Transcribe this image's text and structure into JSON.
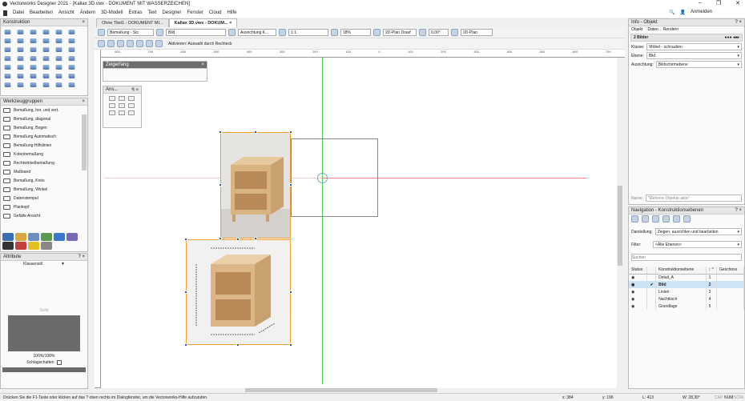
{
  "window": {
    "title": "Vectorworks Designer 2021 - [Kallax 3D.vwx - DOKUMENT MIT WASSERZEICHEN]",
    "controls": [
      "–",
      "❐",
      "✕"
    ]
  },
  "menu": [
    "Datei",
    "Bearbeiten",
    "Ansicht",
    "Ändern",
    "3D-Modell",
    "Extras",
    "Text",
    "Designer",
    "Fenster",
    "Cloud",
    "Hilfe"
  ],
  "account": {
    "login": "Anmelden"
  },
  "tabs": [
    {
      "label": "Ohne Titel1 - DOKUMENT MI..."
    },
    {
      "label": "Kallax 3D.vwx - DOKUM... ×"
    }
  ],
  "toolbar": {
    "class": "Bemaßung - Stc",
    "layer": "Bild",
    "alignment": "Ausrichtung K...",
    "scale": "1:1",
    "zoom": "18%",
    "view": "2D-Plan Drauf",
    "angle": "0.00°",
    "render": "2D-Plan",
    "mode_text": "Aktivieren: Auswahl durch Rechteck"
  },
  "ruler": {
    "h": [
      "800",
      "700",
      "600",
      "500",
      "400",
      "300",
      "200",
      "100",
      "0",
      "100",
      "200",
      "300",
      "400",
      "500",
      "600",
      "700"
    ]
  },
  "panels": {
    "konstruktion": {
      "title": "Konstruktion"
    },
    "werkzeuggruppen": {
      "title": "Werkzeuggruppen",
      "items": [
        "Bemaßung, hor. und vert.",
        "Bemaßung, diagonal",
        "Bemaßung, Bogen",
        "Bemaßung Automatisch",
        "Bemaßung Hilfslinien",
        "Kotenbemaßung",
        "Rechtwinkelbemaßung",
        "Maßband",
        "Bemaßung, Kreis",
        "Bemaßung, Winkel",
        "Datenstempel",
        "Plankopf",
        "Gefälle Ansicht"
      ]
    },
    "attribute": {
      "title": "Attribute",
      "fill": "Klassenstil",
      "line": "Solid",
      "opacity": "100%/100%",
      "shadow": "Schlagschatten"
    },
    "zeigerfang": {
      "title": "Zeigerfang"
    },
    "ans": {
      "title": "Ans..."
    },
    "info": {
      "title": "Info - Objekt",
      "tabs": [
        "Objekt",
        "Daten",
        "Rendern"
      ],
      "selection": "2 Bilder",
      "fields": [
        {
          "label": "Klasse:",
          "value": "Möbel - schrauben"
        },
        {
          "label": "Ebene:",
          "value": "Bild"
        },
        {
          "label": "Ausrichtung:",
          "value": "Bildschirmebene"
        }
      ],
      "name_label": "Name:",
      "name_value": "\"Mehrere Objekte aktiv\""
    },
    "navigation": {
      "title": "Navigation - Konstruktionsebenen",
      "darstellung_label": "Darstellung:",
      "darstellung": "Zeigen, ausrichten und bearbeiten",
      "filter_label": "Filter:",
      "filter": "<Alle Ebenen>",
      "search_placeholder": "Suchen",
      "columns": [
        "Status",
        "",
        "Konstruktionsebene",
        "↕ ^",
        "Geschoss"
      ],
      "rows": [
        {
          "name": "Detail_A",
          "n": "1",
          "check": ""
        },
        {
          "name": "Bild",
          "n": "2",
          "check": "✔",
          "active": true
        },
        {
          "name": "Linien",
          "n": "3",
          "check": ""
        },
        {
          "name": "Nachttisch",
          "n": "4",
          "check": ""
        },
        {
          "name": "Grundlage",
          "n": "5",
          "check": ""
        }
      ]
    }
  },
  "status": {
    "hint": "Drücken Sie die F1-Taste oder klicken auf das ? oben rechts im Dialogfenster, um die Vectorworks-Hilfe aufzurufen.",
    "x": "x: 384",
    "y": "y: 196",
    "l": "L: 413",
    "w": "W: 28,30°",
    "caps": "CAP",
    "num": "NUM",
    "scrl": "SCRL"
  },
  "colors": {
    "selection": "#f0a030",
    "guide_green": "#50c050",
    "guide_red": "#f08080",
    "handle": "#3050a0"
  }
}
